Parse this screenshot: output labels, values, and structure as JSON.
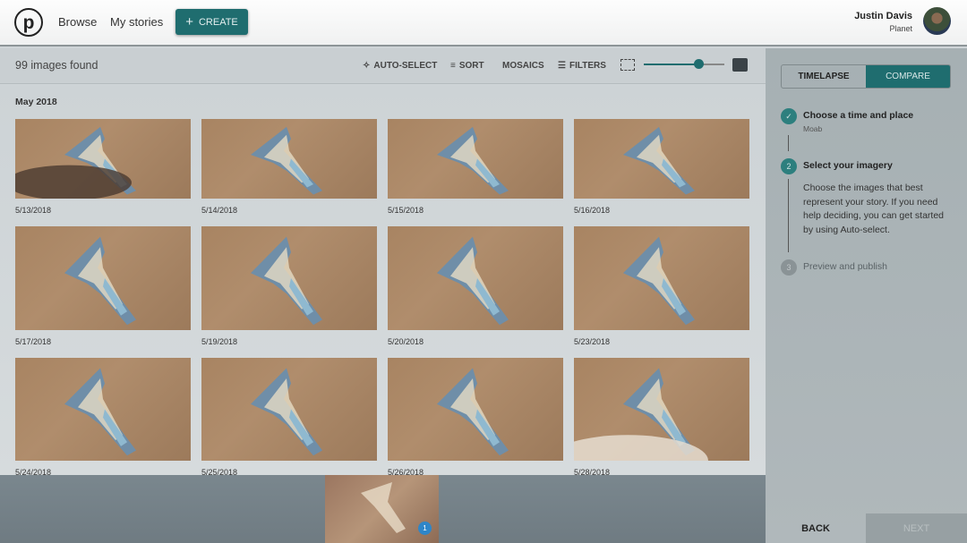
{
  "header": {
    "logo": "p",
    "nav": [
      "Browse",
      "My stories"
    ],
    "create_label": "CREATE",
    "user_name": "Justin Davis",
    "user_org": "Planet"
  },
  "toolbar": {
    "count": "99 images found",
    "auto_select": "AUTO-SELECT",
    "sort": "SORT",
    "mosaics": "MOSAICS",
    "filters": "FILTERS",
    "thumb_size_percent": 68
  },
  "main": {
    "month": "May 2018",
    "images": [
      "5/13/2018",
      "5/14/2018",
      "5/15/2018",
      "5/16/2018",
      "5/17/2018",
      "5/19/2018",
      "5/20/2018",
      "5/23/2018",
      "5/24/2018",
      "5/25/2018",
      "5/26/2018",
      "5/28/2018"
    ]
  },
  "tray": {
    "selected_count": "1"
  },
  "sidebar": {
    "tabs": [
      "TIMELAPSE",
      "COMPARE"
    ],
    "active_tab": "COMPARE",
    "steps": [
      {
        "num": "",
        "title": "Choose a time and place",
        "sub": "Moab"
      },
      {
        "num": "2",
        "title": "Select your imagery",
        "desc": "Choose the images that best represent your story. If you need help deciding, you can get started by using Auto-select."
      },
      {
        "num": "3",
        "title": "Preview and publish"
      }
    ],
    "back": "BACK",
    "next": "NEXT"
  },
  "colors": {
    "accent": "#1f6d6f",
    "badge": "#2f86c8"
  }
}
